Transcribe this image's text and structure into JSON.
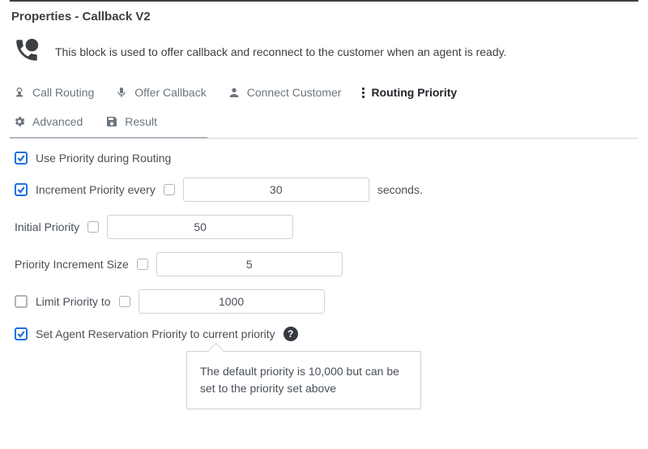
{
  "header": {
    "title": "Properties - Callback V2",
    "description": "This block is used to offer callback and reconnect to the customer when an agent is ready."
  },
  "tabs": {
    "row1": [
      {
        "label": "Call Routing"
      },
      {
        "label": "Offer Callback"
      },
      {
        "label": "Connect Customer"
      },
      {
        "label": "Routing Priority",
        "active": true
      }
    ],
    "row2": [
      {
        "label": "Advanced"
      },
      {
        "label": "Result"
      }
    ]
  },
  "form": {
    "use_priority": {
      "label": "Use Priority during Routing",
      "checked": true
    },
    "increment_every": {
      "label": "Increment Priority every",
      "checked": true,
      "value": "30",
      "suffix": "seconds."
    },
    "initial_priority": {
      "label": "Initial Priority",
      "value": "50"
    },
    "increment_size": {
      "label": "Priority Increment Size",
      "value": "5"
    },
    "limit_priority": {
      "label": "Limit Priority to",
      "checked": false,
      "value": "1000"
    },
    "set_agent_reservation": {
      "label": "Set Agent Reservation Priority to current priority",
      "checked": true,
      "help": "The default priority is 10,000 but can be set to the priority set above"
    }
  }
}
